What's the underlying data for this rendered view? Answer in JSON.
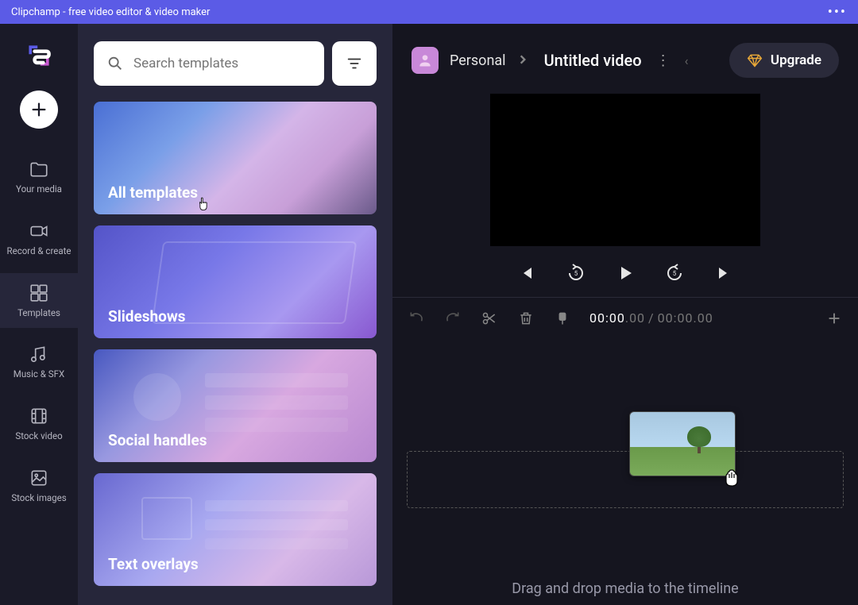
{
  "titlebar": {
    "text": "Clipchamp - free video editor & video maker"
  },
  "search": {
    "placeholder": "Search templates"
  },
  "nav": {
    "items": [
      {
        "label": "Your media"
      },
      {
        "label": "Record & create"
      },
      {
        "label": "Templates"
      },
      {
        "label": "Music & SFX"
      },
      {
        "label": "Stock video"
      },
      {
        "label": "Stock images"
      }
    ]
  },
  "templates": {
    "cards": [
      {
        "title": "All templates"
      },
      {
        "title": "Slideshows"
      },
      {
        "title": "Social handles"
      },
      {
        "title": "Text overlays"
      }
    ]
  },
  "header": {
    "workspace": "Personal",
    "project_title": "Untitled video",
    "upgrade_label": "Upgrade"
  },
  "timeline": {
    "current": "00:00",
    "current_frac": ".00",
    "total": "00:00",
    "total_frac": ".00",
    "drop_hint": "Drag and drop media to the timeline"
  }
}
